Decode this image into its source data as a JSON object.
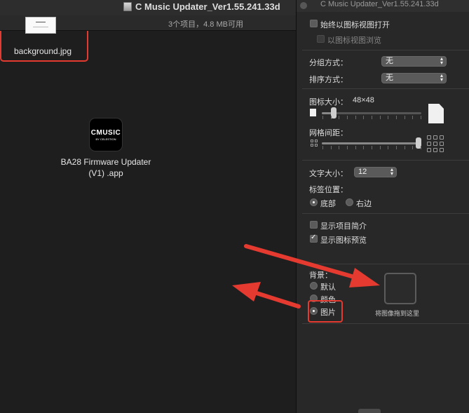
{
  "window": {
    "title": "C Music Updater_Ver1.55.241.33d",
    "status": "3个项目，4.8 MB可用"
  },
  "files": [
    {
      "name": "BA28 Firmware Updater (V1) .app",
      "line1": "BA28 Firmware Updater",
      "line2": "(V1) .app",
      "icon_text": "CMUSIC",
      "icon_subtext": "BY CELESTION"
    },
    {
      "name": "background.jpg"
    }
  ],
  "panel": {
    "title": "C Music Updater_Ver1.55.241.33d",
    "always_open_icon_view": "始终以图标视图打开",
    "browse_icon_view": "以图标视图浏览",
    "group_by_label": "分组方式：",
    "group_by_value": "无",
    "sort_by_label": "排序方式：",
    "sort_by_value": "无",
    "icon_size_label": "图标大小：",
    "icon_size_value": "48×48",
    "icon_size_fraction": 0.1,
    "grid_spacing_label": "网格间距：",
    "grid_spacing_fraction": 1.0,
    "text_size_label": "文字大小：",
    "text_size_value": "12",
    "label_position_label": "标签位置：",
    "label_bottom": "底部",
    "label_right": "右边",
    "show_item_info": "显示项目简介",
    "show_icon_preview": "显示图标预览",
    "background_label": "背景：",
    "bg_default": "默认",
    "bg_color": "颜色",
    "bg_picture": "图片",
    "drop_hint": "将图像拖到这里"
  },
  "colors": {
    "highlight": "#e53a2f",
    "background": "#1e1e1e",
    "panel": "#282828"
  }
}
